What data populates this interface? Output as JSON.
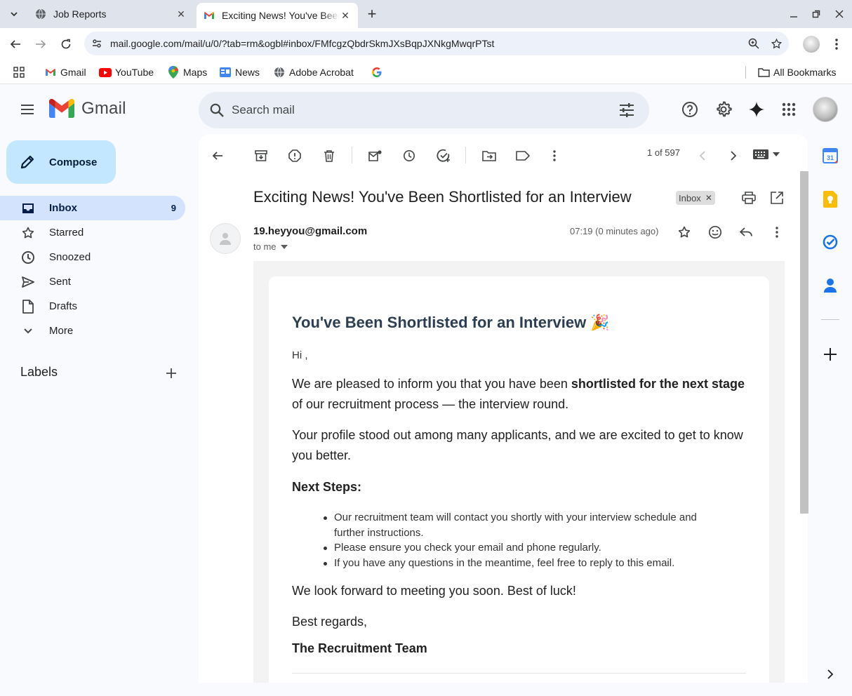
{
  "browser": {
    "tabs": [
      {
        "title": "Job Reports",
        "active": false
      },
      {
        "title": "Exciting News! You've Been Shortlisted for an Interview",
        "active": true
      }
    ],
    "url": "mail.google.com/mail/u/0/?tab=rm&ogbl#inbox/FMfcgzQbdrSkmJXsBqpJXNkgMwqrPTst",
    "bookmarks": [
      "Gmail",
      "YouTube",
      "Maps",
      "News",
      "Adobe Acrobat"
    ],
    "all_bookmarks": "All Bookmarks"
  },
  "gmail": {
    "logo_text": "Gmail",
    "search_placeholder": "Search mail",
    "compose_label": "Compose",
    "nav": [
      {
        "label": "Inbox",
        "count": "9",
        "icon": "inbox-icon",
        "active": true
      },
      {
        "label": "Starred",
        "count": "",
        "icon": "star-icon"
      },
      {
        "label": "Snoozed",
        "count": "",
        "icon": "clock-icon"
      },
      {
        "label": "Sent",
        "count": "",
        "icon": "send-icon"
      },
      {
        "label": "Drafts",
        "count": "",
        "icon": "draft-icon"
      },
      {
        "label": "More",
        "count": "",
        "icon": "chevron-down-icon"
      }
    ],
    "labels_heading": "Labels"
  },
  "message": {
    "pager": "1 of 597",
    "subject": "Exciting News! You've Been Shortlisted for an Interview",
    "chip": "Inbox",
    "sender": "19.heyyou@gmail.com",
    "to": "to me",
    "time": "07:19 (0 minutes ago)",
    "body": {
      "heading": "You've Been Shortlisted for an Interview 🎉",
      "greeting": "Hi ,",
      "p1_before": "We are pleased to inform you that you have been ",
      "p1_bold": "shortlisted for the next stage",
      "p1_after": " of our recruitment process — the interview round.",
      "p2": "Your profile stood out among many applicants, and we are excited to get to know you better.",
      "next_steps": "Next Steps:",
      "steps": [
        "Our recruitment team will contact you shortly with your interview schedule and further instructions.",
        "Please ensure you check your email and phone regularly.",
        "If you have any questions in the meantime, feel free to reply to this email."
      ],
      "closing": "We look forward to meeting you soon. Best of luck!",
      "regards": "Best regards,",
      "signature": "The Recruitment Team"
    }
  },
  "colors": {
    "compose_bg": "#c2e7ff",
    "active_nav_bg": "#d3e3fd",
    "heading_color": "#2c3e50"
  }
}
